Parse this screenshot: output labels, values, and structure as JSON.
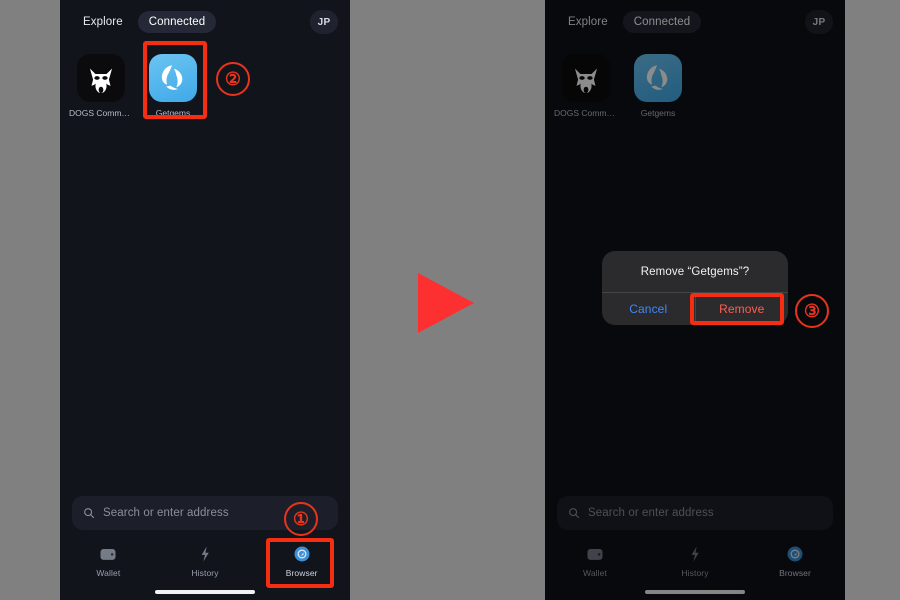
{
  "annotations": {
    "step_1": "①",
    "step_2": "②",
    "step_3": "③",
    "arrow": "play-arrow-right",
    "highlight_color": "#f52d12",
    "circle_color": "#e8341c",
    "arrow_color": "#fc3030"
  },
  "left_phone": {
    "topbar": {
      "tabs": [
        {
          "label": "Explore",
          "active": false
        },
        {
          "label": "Connected",
          "active": true
        }
      ],
      "avatar": "JP"
    },
    "apps": [
      {
        "name": "DOGS Commu...",
        "icon": "dogs-icon",
        "icon_bg": "#0b0b0d",
        "highlighted": false
      },
      {
        "name": "Getgems",
        "icon": "getgems-icon",
        "icon_bg": "#3fa9e8",
        "highlighted": true
      }
    ],
    "search": {
      "placeholder": "Search or enter address",
      "icon": "search-icon"
    },
    "nav": [
      {
        "label": "Wallet",
        "icon": "wallet-icon",
        "active": false
      },
      {
        "label": "History",
        "icon": "history-icon",
        "active": false
      },
      {
        "label": "Browser",
        "icon": "compass-icon",
        "active": true
      }
    ]
  },
  "right_phone": {
    "topbar": {
      "tabs": [
        {
          "label": "Explore",
          "active": false
        },
        {
          "label": "Connected",
          "active": true
        }
      ],
      "avatar": "JP"
    },
    "apps": [
      {
        "name": "DOGS Commu...",
        "icon": "dogs-icon",
        "icon_bg": "#0b0b0d",
        "highlighted": false
      },
      {
        "name": "Getgems",
        "icon": "getgems-icon",
        "icon_bg": "#3fa9e8",
        "highlighted": false
      }
    ],
    "search": {
      "placeholder": "Search or enter address",
      "icon": "search-icon"
    },
    "nav": [
      {
        "label": "Wallet",
        "icon": "wallet-icon",
        "active": false
      },
      {
        "label": "History",
        "icon": "history-icon",
        "active": false
      },
      {
        "label": "Browser",
        "icon": "compass-icon",
        "active": true
      }
    ],
    "dialog": {
      "title": "Remove “Getgems”?",
      "cancel_label": "Cancel",
      "confirm_label": "Remove",
      "cancel_color": "#3f87f5",
      "confirm_color": "#ff5f52"
    }
  }
}
